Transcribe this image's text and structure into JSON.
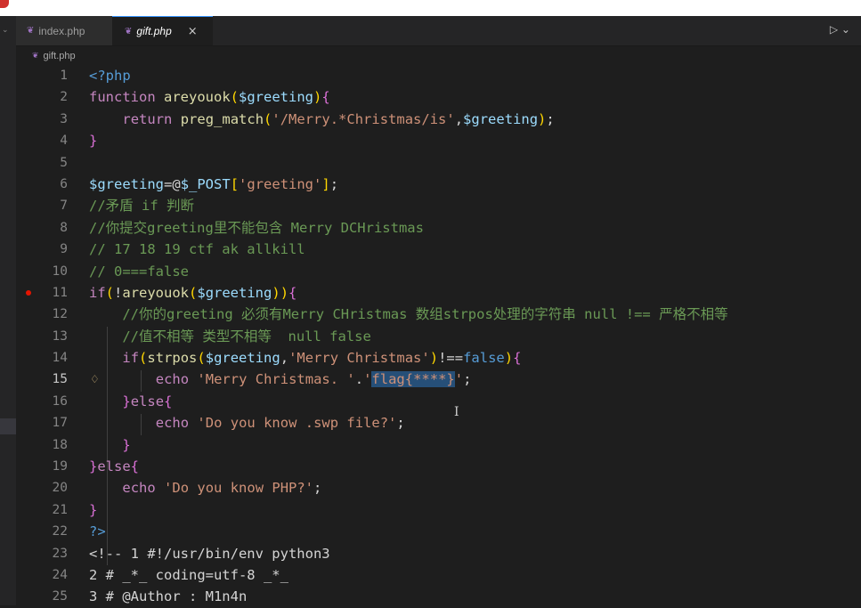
{
  "tabs": [
    {
      "label": "index.php",
      "icon": "php-elephant-icon",
      "active": false
    },
    {
      "label": "gift.php",
      "icon": "php-elephant-icon",
      "active": true,
      "close": "×"
    }
  ],
  "run_button": "▷ ⌄",
  "breadcrumb": {
    "file": "gift.php"
  },
  "editor": {
    "active_line": 15,
    "breakpoint_line": 11,
    "lines": [
      {
        "n": "1",
        "t": "<?php"
      },
      {
        "n": "2",
        "t": "function areyouok($greeting){"
      },
      {
        "n": "3",
        "t": "    return preg_match('/Merry.*Christmas/is',$greeting);"
      },
      {
        "n": "4",
        "t": "}"
      },
      {
        "n": "5",
        "t": ""
      },
      {
        "n": "6",
        "t": "$greeting=@$_POST['greeting'];"
      },
      {
        "n": "7",
        "t": "//矛盾 if 判断"
      },
      {
        "n": "8",
        "t": "//你提交greeting里不能包含 Merry DCHristmas"
      },
      {
        "n": "9",
        "t": "// 17 18 19 ctf ak allkill"
      },
      {
        "n": "10",
        "t": "// 0===false"
      },
      {
        "n": "11",
        "t": "if(!areyouok($greeting)){"
      },
      {
        "n": "12",
        "t": "    //你的greeting 必须有Merry CHristmas 数组strpos处理的字符串 null !== 严格不相等"
      },
      {
        "n": "13",
        "t": "    //值不相等 类型不相等  null false"
      },
      {
        "n": "14",
        "t": "    if(strpos($greeting,'Merry Christmas')!==false){"
      },
      {
        "n": "15",
        "t": "        echo 'Merry Christmas. '.'flag{****}';"
      },
      {
        "n": "16",
        "t": "    }else{"
      },
      {
        "n": "17",
        "t": "        echo 'Do you know .swp file?';"
      },
      {
        "n": "18",
        "t": "    }"
      },
      {
        "n": "19",
        "t": "}else{"
      },
      {
        "n": "20",
        "t": "    echo 'Do you know PHP?';"
      },
      {
        "n": "21",
        "t": "}"
      },
      {
        "n": "22",
        "t": "?>"
      },
      {
        "n": "23",
        "t": "<!-- 1 #!/usr/bin/env python3"
      },
      {
        "n": "24",
        "t": "2 # _*_ coding=utf-8 _*_"
      },
      {
        "n": "25",
        "t": "3 # @Author : M1n4n"
      }
    ],
    "selection_text": "flag{****}"
  },
  "colors": {
    "keyword": "#c586c0",
    "function": "#dcdcaa",
    "variable": "#9cdcfe",
    "string": "#ce9178",
    "comment": "#6a9955",
    "selection": "#264f78"
  }
}
